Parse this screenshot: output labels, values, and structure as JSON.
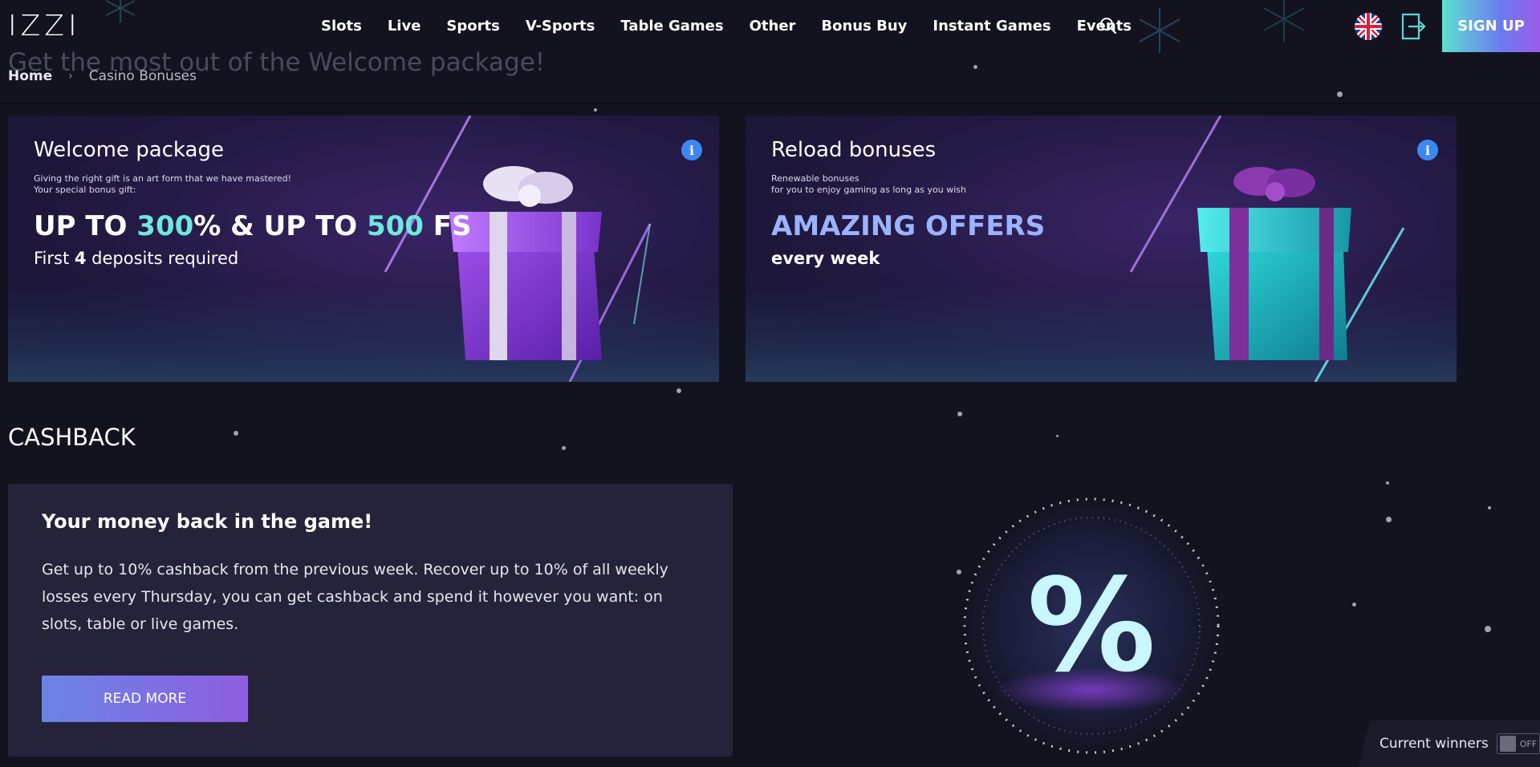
{
  "header": {
    "logo": "IZZI",
    "nav": [
      "Slots",
      "Live",
      "Sports",
      "V-Sports",
      "Table Games",
      "Other",
      "Bonus Buy",
      "Instant Games",
      "Events"
    ],
    "signup_label": "SIGN UP",
    "icons": [
      "search-icon",
      "uk-flag-icon",
      "login-icon"
    ]
  },
  "page": {
    "ghost_title": "Get the most out of the Welcome package!",
    "breadcrumb": {
      "home": "Home",
      "separator": "›",
      "current": "Casino Bonuses"
    }
  },
  "cards": [
    {
      "title": "Welcome package",
      "subtitle_lines": [
        "Giving the right gift is an art form that we have mastered!",
        "Your special bonus gift:"
      ],
      "headline": {
        "p1": "UP TO ",
        "v1": "300",
        "p2": "% & UP TO ",
        "v2": "500",
        "p3": " FS"
      },
      "line": {
        "p1": "First ",
        "bold": "4",
        "p2": " deposits required"
      },
      "info": "i"
    },
    {
      "title": "Reload bonuses",
      "subtitle_lines": [
        "Renewable bonuses",
        "for you to enjoy gaming as long as you wish"
      ],
      "headline": "AMAZING OFFERS",
      "line": "every week",
      "info": "i"
    }
  ],
  "cashback": {
    "section_title": "CASHBACK",
    "heading": "Your money back in the game!",
    "text": "Get up to 10% cashback from the previous week. Recover up to 10% of all weekly losses every Thursday, you can get cashback and spend it however you want: on slots, table or live games.",
    "button": "READ MORE",
    "graphic_symbol": "%"
  },
  "winners": {
    "label": "Current winners",
    "toggle": "OFF"
  },
  "colors": {
    "accent_teal": "#6ee7dc",
    "accent_blue": "#9bb3ff",
    "info_blue": "#3c86f2",
    "background": "#13131f"
  }
}
